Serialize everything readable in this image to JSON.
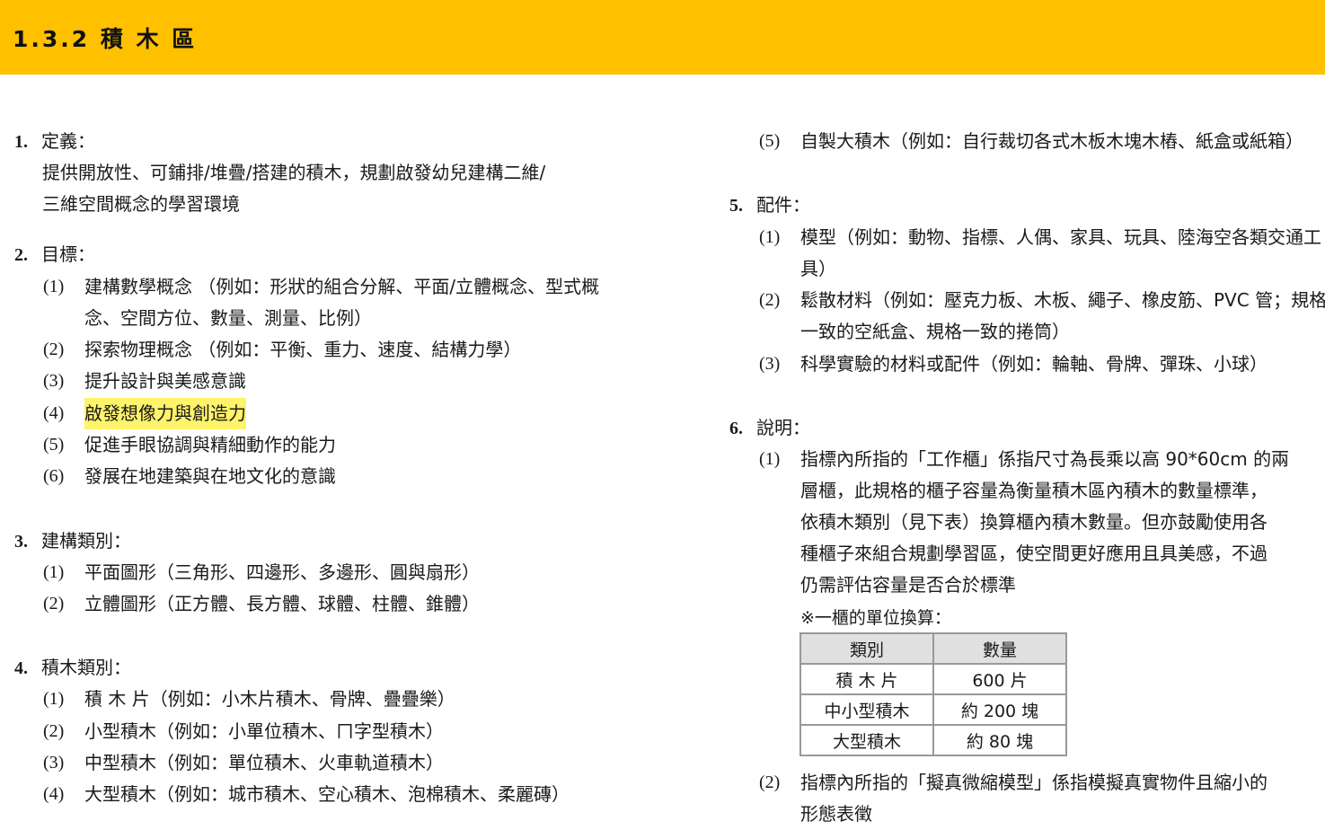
{
  "header": {
    "title": "1.3.2 積 木 區"
  },
  "sections": {
    "s1": {
      "num": "1.",
      "title": "定義：",
      "lines": [
        "提供開放性、可鋪排/堆疊/搭建的積木，規劃啟發幼兒建構二維/",
        "三維空間概念的學習環境"
      ]
    },
    "s2": {
      "num": "2.",
      "title": "目標：",
      "items": [
        {
          "idx": "(1)",
          "lines": [
            "建構數學概念 （例如：形狀的組合分解、平面/立體概念、型式概",
            "念、空間方位、數量、測量、比例）"
          ]
        },
        {
          "idx": "(2)",
          "lines": [
            "探索物理概念 （例如：平衡、重力、速度、結構力學）"
          ]
        },
        {
          "idx": "(3)",
          "lines": [
            "提升設計與美感意識"
          ]
        },
        {
          "idx": "(4)",
          "lines": [
            "啟發想像力與創造力"
          ]
        },
        {
          "idx": "(5)",
          "lines": [
            "促進手眼協調與精細動作的能力"
          ]
        },
        {
          "idx": "(6)",
          "lines": [
            "發展在地建築與在地文化的意識"
          ]
        }
      ]
    },
    "s3": {
      "num": "3.",
      "title": "建構類別：",
      "items": [
        {
          "idx": "(1)",
          "lines": [
            "平面圖形（三角形、四邊形、多邊形、圓與扇形）"
          ]
        },
        {
          "idx": "(2)",
          "lines": [
            "立體圖形（正方體、長方體、球體、柱體、錐體）"
          ]
        }
      ]
    },
    "s4": {
      "num": "4.",
      "title": "積木類別：",
      "items": [
        {
          "idx": "(1)",
          "lines": [
            "積 木 片（例如：小木片積木、骨牌、疊疊樂）"
          ]
        },
        {
          "idx": "(2)",
          "lines": [
            "小型積木（例如：小單位積木、ㄇ字型積木）"
          ]
        },
        {
          "idx": "(3)",
          "lines": [
            "中型積木（例如：單位積木、火車軌道積木）"
          ]
        },
        {
          "idx": "(4)",
          "lines": [
            "大型積木（例如：城市積木、空心積木、泡棉積木、柔麗磚）"
          ]
        },
        {
          "idx": "(5)",
          "lines": [
            "自製大積木（例如：自行裁切各式木板木塊木樁、紙盒或紙箱）"
          ]
        }
      ]
    },
    "s5": {
      "num": "5.",
      "title": "配件：",
      "items": [
        {
          "idx": "(1)",
          "lines": [
            "模型（例如：動物、指標、人偶、家具、玩具、陸海空各類交通工",
            "具）"
          ]
        },
        {
          "idx": "(2)",
          "lines": [
            "鬆散材料（例如：壓克力板、木板、繩子、橡皮筋、PVC 管；規格",
            "一致的空紙盒、規格一致的捲筒）"
          ]
        },
        {
          "idx": "(3)",
          "lines": [
            "科學實驗的材料或配件（例如：輪軸、骨牌、彈珠、小球）"
          ]
        }
      ]
    },
    "s6": {
      "num": "6.",
      "title": "說明：",
      "items": [
        {
          "idx": "(1)",
          "lines": [
            "指標內所指的「工作櫃」係指尺寸為長乘以高 90*60cm 的兩",
            "層櫃，此規格的櫃子容量為衡量積木區內積木的數量標準，",
            "依積木類別（見下表）換算櫃內積木數量。但亦鼓勵使用各",
            "種櫃子來組合規劃學習區，使空間更好應用且具美感，不過",
            "仍需評估容量是否合於標準"
          ]
        },
        {
          "idx": "(2)",
          "lines": [
            "指標內所指的「擬真微縮模型」係指模擬真實物件且縮小的",
            "形態表徵"
          ]
        }
      ],
      "note": "※一櫃的單位換算：",
      "table": {
        "headers": [
          "類別",
          "數量"
        ],
        "rows": [
          [
            "積 木 片",
            "600 片"
          ],
          [
            "中小型積木",
            "約 200 塊"
          ],
          [
            "大型積木",
            "約 80 塊"
          ]
        ]
      }
    }
  }
}
